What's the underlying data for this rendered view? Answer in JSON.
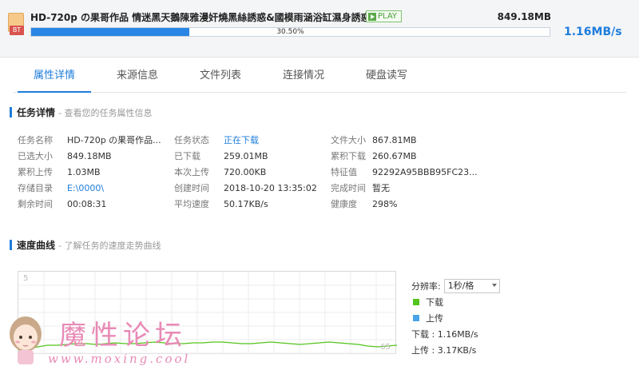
{
  "header": {
    "file_badge": "BT",
    "title": "HD-720p の果哥作品 情迷黑天鵝陳雅漫奸燒黑絲誘惑&國模雨涵浴缸濕身誘惑等 3V",
    "play_label": "PLAY",
    "size": "849.18MB",
    "progress_label": "30.50%",
    "progress_value": 0.305,
    "speed": "1.16MB/s"
  },
  "tabs": [
    {
      "label": "属性详情",
      "active": true
    },
    {
      "label": "来源信息",
      "active": false
    },
    {
      "label": "文件列表",
      "active": false
    },
    {
      "label": "连接情况",
      "active": false
    },
    {
      "label": "硬盘读写",
      "active": false
    }
  ],
  "details": {
    "title": "任务详情",
    "subtitle": "- 查看您的任务属性信息",
    "rows": [
      [
        {
          "label": "任务名称",
          "value": "HD-720p の果哥作品..."
        },
        {
          "label": "任务状态",
          "value": "正在下载"
        },
        {
          "label": "文件大小",
          "value": "867.81MB"
        }
      ],
      [
        {
          "label": "已选大小",
          "value": "849.18MB"
        },
        {
          "label": "已下载",
          "value": "259.01MB"
        },
        {
          "label": "累积下载",
          "value": "260.67MB"
        }
      ],
      [
        {
          "label": "累积上传",
          "value": "1.03MB"
        },
        {
          "label": "本次上传",
          "value": "720.00KB"
        },
        {
          "label": "特征值",
          "value": "92292A95BBB95FC23..."
        }
      ],
      [
        {
          "label": "存储目录",
          "value": "E:\\0000\\"
        },
        {
          "label": "创建时间",
          "value": "2018-10-20 13:35:02"
        },
        {
          "label": "完成时间",
          "value": "暂无"
        }
      ],
      [
        {
          "label": "剩余时间",
          "value": "00:08:31"
        },
        {
          "label": "平均速度",
          "value": "50.17KB/s"
        },
        {
          "label": "健康度",
          "value": "298%"
        }
      ]
    ]
  },
  "speed_curve": {
    "title": "速度曲线",
    "subtitle": "- 了解任务的速度走势曲线",
    "axis_top": "5",
    "axis_right": "65",
    "resolution_label": "分辨率:",
    "resolution_value": "1秒/格",
    "legend_download": "下载",
    "legend_upload": "上传",
    "download_speed": "下载 : 1.16MB/s",
    "upload_speed": "上传 : 3.17KB/s",
    "download_color": "#52c41a",
    "upload_color": "#4aa3e8"
  },
  "watermark": {
    "big": "魔性论坛",
    "small": "www.moxing.cool"
  }
}
